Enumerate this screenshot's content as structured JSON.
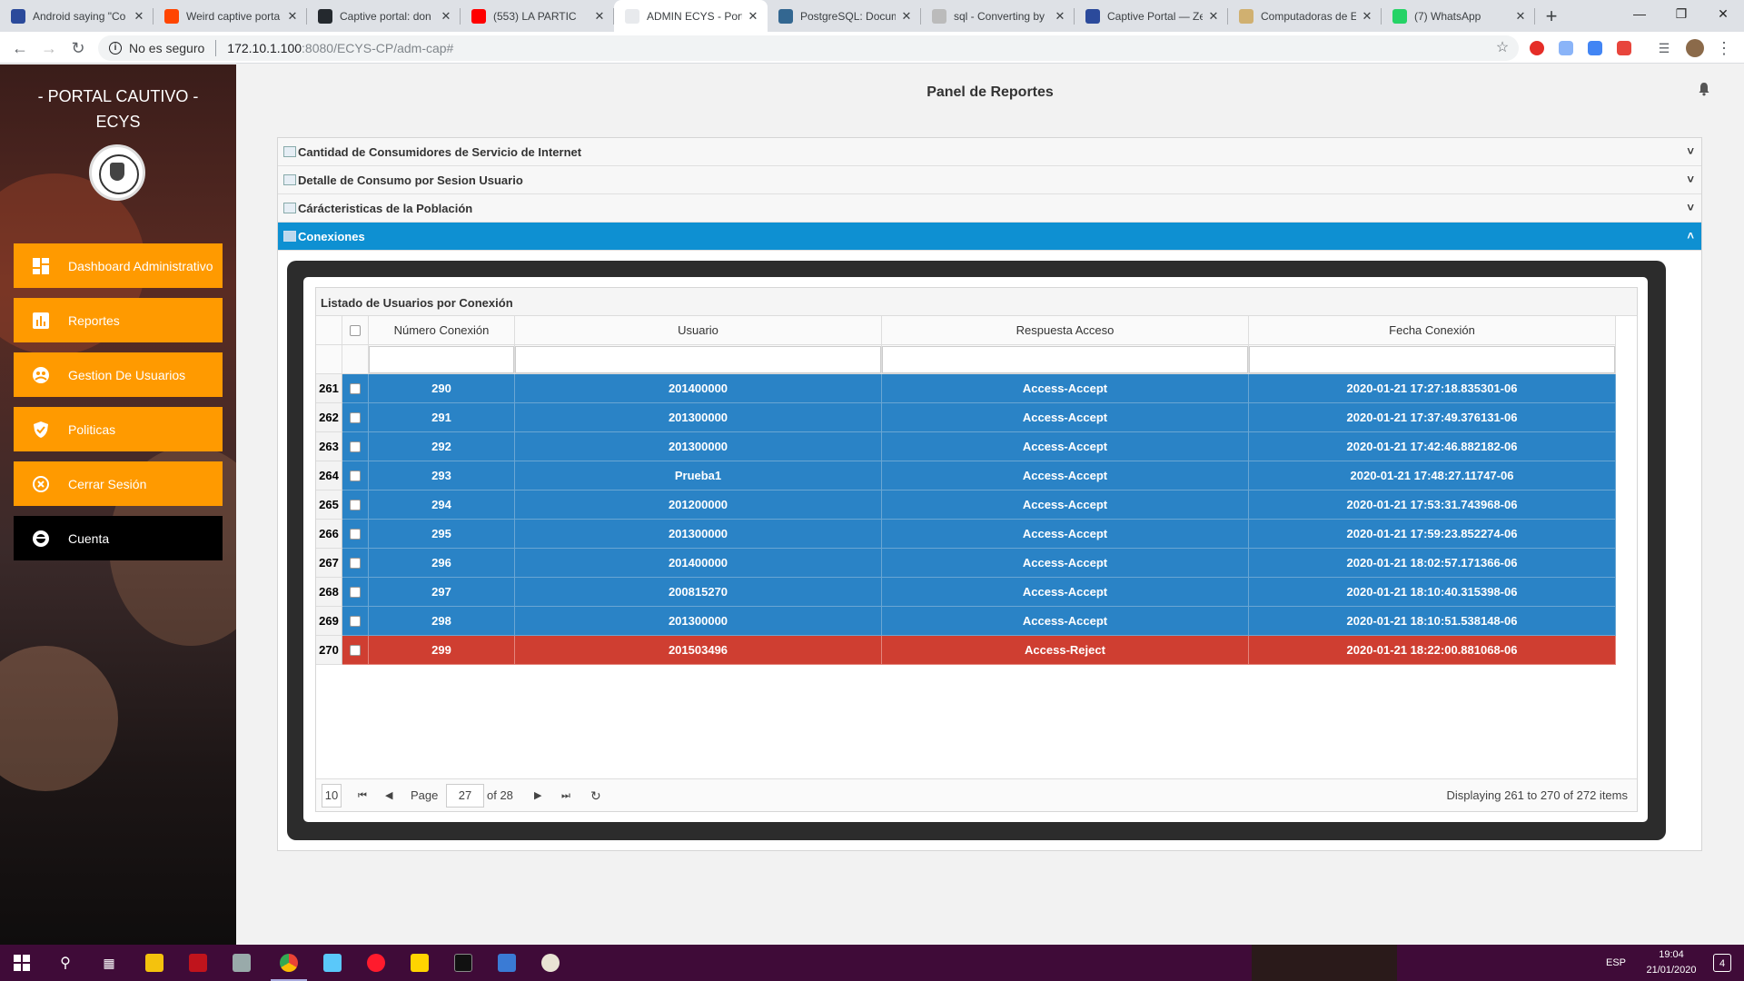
{
  "browser": {
    "tabs": [
      {
        "title": "Android saying \"Co",
        "color": "#2b4a9b"
      },
      {
        "title": "Weird captive porta",
        "color": "#ff4500"
      },
      {
        "title": "Captive portal: don",
        "color": "#24292e"
      },
      {
        "title": "(553) LA PARTIC",
        "color": "#ff0000"
      },
      {
        "title": "ADMIN ECYS - Port",
        "color": "#e8eaed",
        "active": true
      },
      {
        "title": "PostgreSQL: Docum",
        "color": "#336791"
      },
      {
        "title": "sql - Converting by",
        "color": "#bbbbbb"
      },
      {
        "title": "Captive Portal — Ze",
        "color": "#2b4a9b"
      },
      {
        "title": "Computadoras de E",
        "color": "#d0b070"
      },
      {
        "title": "(7) WhatsApp",
        "color": "#25d366"
      }
    ],
    "url": {
      "security": "No es seguro",
      "host": "172.10.1.100",
      "rest": ":8080/ECYS-CP/adm-cap#"
    }
  },
  "sidebar": {
    "brand_line1": "- PORTAL CAUTIVO -",
    "brand_line2": "ECYS",
    "items": [
      {
        "label": "Dashboard Administrativo",
        "icon": "dashboard-icon"
      },
      {
        "label": "Reportes",
        "icon": "bar-chart-icon"
      },
      {
        "label": "Gestion De Usuarios",
        "icon": "users-icon"
      },
      {
        "label": "Politicas",
        "icon": "shield-icon"
      },
      {
        "label": "Cerrar Sesión",
        "icon": "close-circle-icon"
      },
      {
        "label": "Cuenta",
        "icon": "account-icon"
      }
    ]
  },
  "main": {
    "title": "Panel de Reportes",
    "accordion": [
      {
        "label": "Cantidad de Consumidores de Servicio de Internet",
        "open": false
      },
      {
        "label": "Detalle de Consumo por Sesion Usuario",
        "open": false
      },
      {
        "label": "Cárácteristicas de la Población",
        "open": false
      },
      {
        "label": "Conexiones",
        "open": true
      }
    ]
  },
  "grid": {
    "title": "Listado de Usuarios por Conexión",
    "columns": [
      "Número Conexión",
      "Usuario",
      "Respuesta Acceso",
      "Fecha Conexión"
    ],
    "rows": [
      {
        "n": "261",
        "num": "290",
        "user": "201400000",
        "resp": "Access-Accept",
        "date": "2020-01-21 17:27:18.835301-06",
        "status": "accept"
      },
      {
        "n": "262",
        "num": "291",
        "user": "201300000",
        "resp": "Access-Accept",
        "date": "2020-01-21 17:37:49.376131-06",
        "status": "accept"
      },
      {
        "n": "263",
        "num": "292",
        "user": "201300000",
        "resp": "Access-Accept",
        "date": "2020-01-21 17:42:46.882182-06",
        "status": "accept"
      },
      {
        "n": "264",
        "num": "293",
        "user": "Prueba1",
        "resp": "Access-Accept",
        "date": "2020-01-21 17:48:27.11747-06",
        "status": "accept"
      },
      {
        "n": "265",
        "num": "294",
        "user": "201200000",
        "resp": "Access-Accept",
        "date": "2020-01-21 17:53:31.743968-06",
        "status": "accept"
      },
      {
        "n": "266",
        "num": "295",
        "user": "201300000",
        "resp": "Access-Accept",
        "date": "2020-01-21 17:59:23.852274-06",
        "status": "accept"
      },
      {
        "n": "267",
        "num": "296",
        "user": "201400000",
        "resp": "Access-Accept",
        "date": "2020-01-21 18:02:57.171366-06",
        "status": "accept"
      },
      {
        "n": "268",
        "num": "297",
        "user": "200815270",
        "resp": "Access-Accept",
        "date": "2020-01-21 18:10:40.315398-06",
        "status": "accept"
      },
      {
        "n": "269",
        "num": "298",
        "user": "201300000",
        "resp": "Access-Accept",
        "date": "2020-01-21 18:10:51.538148-06",
        "status": "accept"
      },
      {
        "n": "270",
        "num": "299",
        "user": "201503496",
        "resp": "Access-Reject",
        "date": "2020-01-21 18:22:00.881068-06",
        "status": "reject"
      }
    ],
    "pager": {
      "page_size": "10",
      "page_label": "Page",
      "page": "27",
      "of_label": "of 28",
      "display": "Displaying 261 to 270 of 272 items"
    }
  },
  "taskbar": {
    "lang": "ESP",
    "time": "19:04",
    "date": "21/01/2020",
    "notifications": "4"
  }
}
